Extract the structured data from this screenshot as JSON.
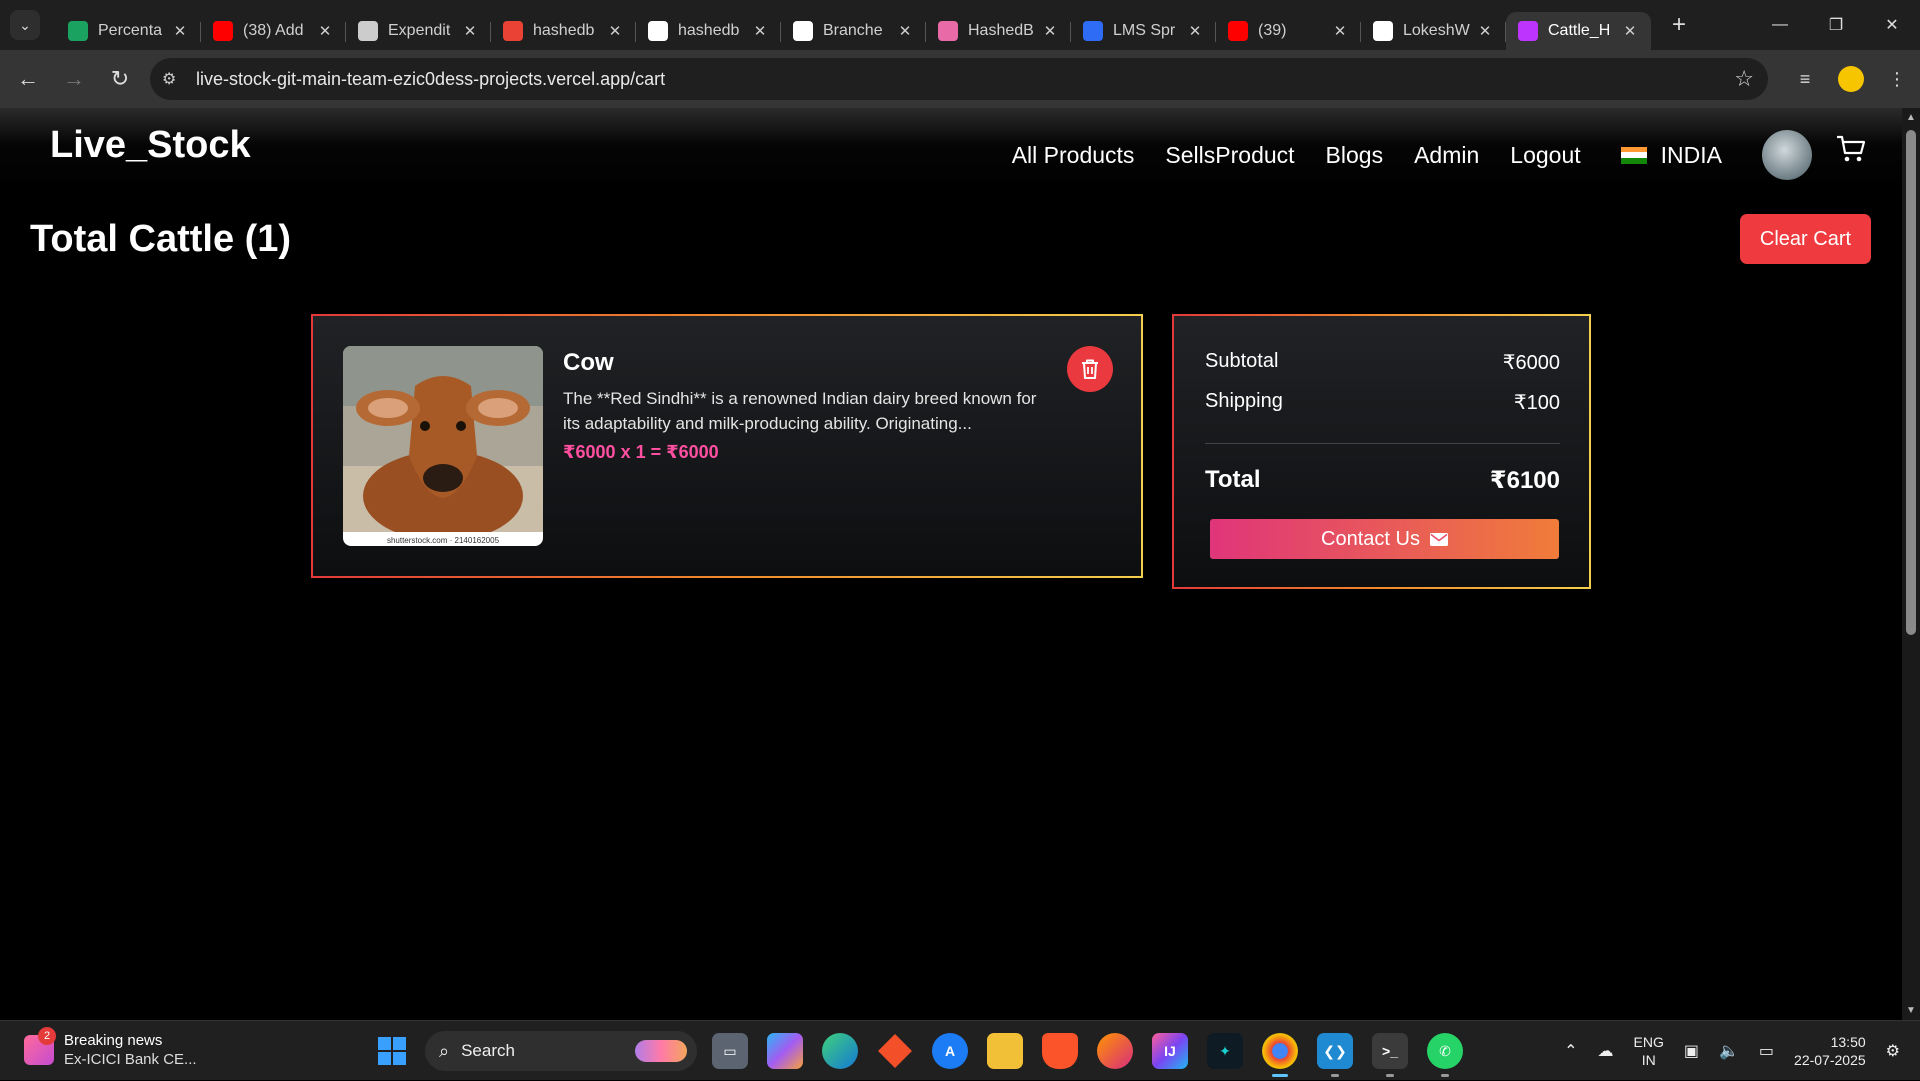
{
  "browser": {
    "tabs": [
      {
        "title": "Percenta",
        "icon": "leaf-icon",
        "color": "#1aa260"
      },
      {
        "title": "(38) Add",
        "icon": "youtube-icon",
        "color": "#ff0000"
      },
      {
        "title": "Expendit",
        "icon": "openai-icon",
        "color": "#cccccc"
      },
      {
        "title": "hashedb",
        "icon": "gmail-icon",
        "color": "#ea4335"
      },
      {
        "title": "hashedb",
        "icon": "github-icon",
        "color": "#ffffff"
      },
      {
        "title": "Branche",
        "icon": "github-icon",
        "color": "#ffffff"
      },
      {
        "title": "HashedB",
        "icon": "hashedbit-icon",
        "color": "#e86aa7"
      },
      {
        "title": "LMS Spr",
        "icon": "lms-icon",
        "color": "#2f6cf5"
      },
      {
        "title": "(39)",
        "icon": "youtube-icon",
        "color": "#ff0000"
      },
      {
        "title": "LokeshW",
        "icon": "github-icon",
        "color": "#ffffff"
      },
      {
        "title": "Cattle_H",
        "icon": "vite-icon",
        "color": "#bd34fe"
      }
    ],
    "url": "live-stock-git-main-team-ezic0dess-projects.vercel.app/cart"
  },
  "site": {
    "brand": "Live_Stock",
    "nav": [
      "All Products",
      "SellsProduct",
      "Blogs",
      "Admin",
      "Logout"
    ],
    "country": "INDIA"
  },
  "cart": {
    "title": "Total Cattle (1)",
    "clear_label": "Clear Cart",
    "item": {
      "name": "Cow",
      "description": "The **Red Sindhi** is a renowned Indian dairy breed known for its adaptability and milk-producing ability. Originating...",
      "price_line": "₹6000 x 1 = ₹6000",
      "watermark": "shutterstock.com · 2140162005"
    },
    "summary": {
      "subtotal_label": "Subtotal",
      "subtotal": "₹6000",
      "shipping_label": "Shipping",
      "shipping": "₹100",
      "total_label": "Total",
      "total": "₹6100",
      "contact_label": "Contact Us"
    }
  },
  "taskbar": {
    "news_badge": "2",
    "news_title": "Breaking news",
    "news_sub": "Ex-ICICI Bank CE...",
    "search_label": "Search",
    "lang_1": "ENG",
    "lang_2": "IN",
    "time": "13:50",
    "date": "22-07-2025"
  }
}
